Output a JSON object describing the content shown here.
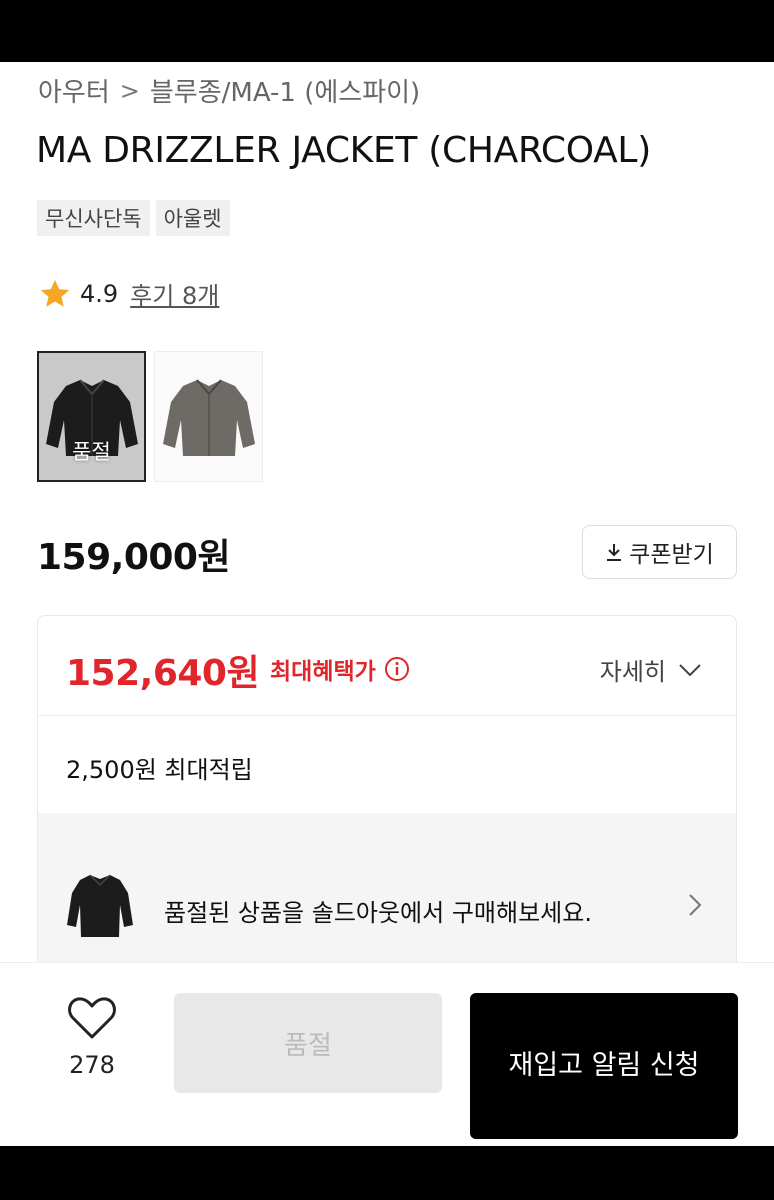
{
  "breadcrumb": {
    "category": "아우터",
    "separator": ">",
    "subcategory": "블루종/MA-1 (에스파이)"
  },
  "product": {
    "title": "MA DRIZZLER JACKET (CHARCOAL)",
    "tags": [
      "무신사단독",
      "아울렛"
    ],
    "rating": "4.9",
    "review_link": "후기 8개",
    "thumbnails": [
      {
        "overlay": "품절",
        "color": "charcoal",
        "selected": true
      },
      {
        "overlay": "",
        "color": "grey",
        "selected": false
      }
    ],
    "price": "159,000원",
    "coupon_label": "쿠폰받기"
  },
  "benefit": {
    "sale_price": "152,640원",
    "max_benefit_label": "최대혜택가",
    "detail_label": "자세히",
    "points": "2,500원 최대적립",
    "soldout_banner": "품절된 상품을 솔드아웃에서 구매해보세요."
  },
  "bottom": {
    "like_count": "278",
    "soldout_button": "품절",
    "restock_button": "재입고 알림 신청"
  },
  "colors": {
    "accent_red": "#e0262a",
    "star": "#f5a623",
    "primary_button": "#000000"
  }
}
